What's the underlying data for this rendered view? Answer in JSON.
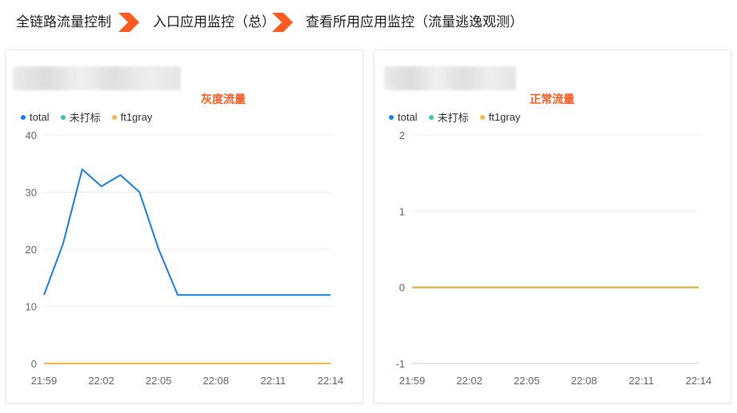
{
  "breadcrumb": {
    "items": [
      "全链路流量控制",
      "入口应用监控（总）",
      "查看所用应用监控（流量逃逸观测）"
    ],
    "arrow_color": "#ff5a1f"
  },
  "legend": [
    {
      "name": "total",
      "color": "#1a7fe8"
    },
    {
      "name": "未打标",
      "color": "#3cc0b4"
    },
    {
      "name": "ft1gray",
      "color": "#f7b84b"
    }
  ],
  "chart_data": [
    {
      "type": "line",
      "title": "灰度流量",
      "x_ticks": [
        "21:59",
        "22:02",
        "22:05",
        "22:08",
        "22:11",
        "22:14"
      ],
      "x_range": [
        0,
        15
      ],
      "ylim": [
        0,
        40
      ],
      "y_ticks": [
        0,
        10,
        20,
        30,
        40
      ],
      "grid": true,
      "legend_position": "top-left",
      "series": [
        {
          "name": "total",
          "x": [
            0,
            1,
            2,
            3,
            4,
            5,
            6,
            7,
            8,
            9,
            10,
            11,
            12,
            13,
            14,
            15
          ],
          "y": [
            12,
            21,
            34,
            31,
            33,
            30,
            20,
            12,
            12,
            12,
            12,
            12,
            12,
            12,
            12,
            12
          ]
        },
        {
          "name": "未打标",
          "x": [
            0,
            15
          ],
          "y": [
            0,
            0
          ]
        },
        {
          "name": "ft1gray",
          "x": [
            0,
            15
          ],
          "y": [
            0,
            0
          ]
        }
      ]
    },
    {
      "type": "line",
      "title": "正常流量",
      "x_ticks": [
        "21:59",
        "22:02",
        "22:05",
        "22:08",
        "22:11",
        "22:14"
      ],
      "x_range": [
        0,
        15
      ],
      "ylim": [
        -1,
        2
      ],
      "y_ticks": [
        -1,
        0,
        1,
        2
      ],
      "grid": true,
      "legend_position": "top-left",
      "series": [
        {
          "name": "total",
          "x": [
            0,
            15
          ],
          "y": [
            0,
            0
          ]
        },
        {
          "name": "未打标",
          "x": [
            0,
            15
          ],
          "y": [
            0,
            0
          ]
        },
        {
          "name": "ft1gray",
          "x": [
            0,
            15
          ],
          "y": [
            0,
            0
          ]
        }
      ]
    }
  ]
}
